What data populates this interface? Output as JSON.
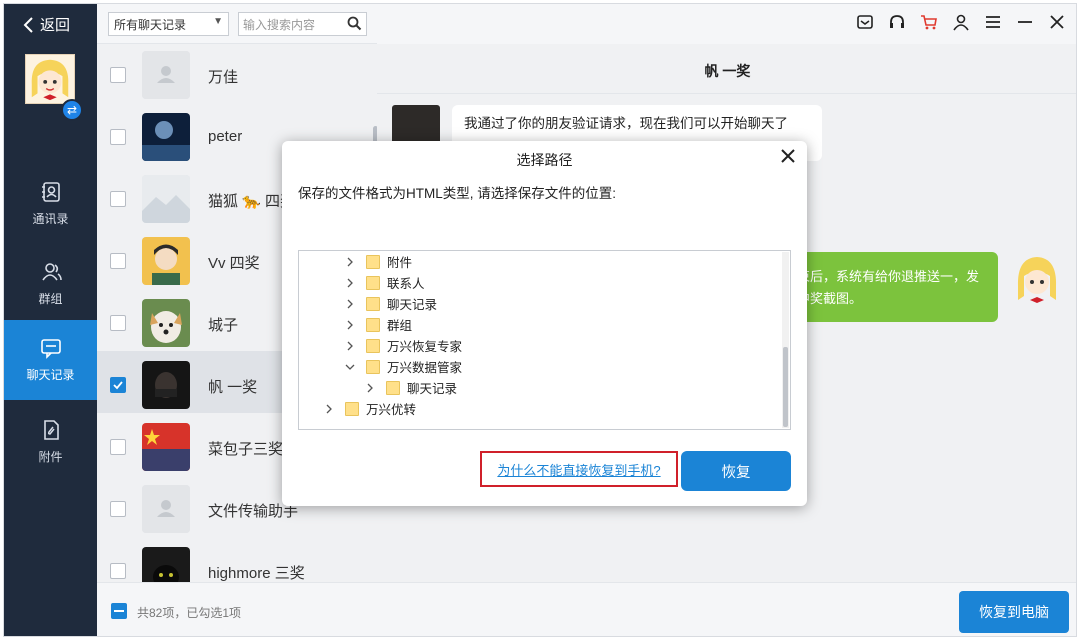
{
  "nav": {
    "back_label": "返回",
    "items": [
      {
        "label": "通讯录",
        "icon": "contacts-icon"
      },
      {
        "label": "群组",
        "icon": "group-icon"
      },
      {
        "label": "聊天记录",
        "icon": "chat-icon"
      },
      {
        "label": "附件",
        "icon": "attachment-icon"
      }
    ],
    "active_index": 2
  },
  "toolbar": {
    "filter_value": "所有聊天记录",
    "search_placeholder": "输入搜索内容"
  },
  "contacts": [
    {
      "name": "万佳",
      "checked": false
    },
    {
      "name": "peter",
      "checked": false
    },
    {
      "name": "猫狐 🐆 四奖",
      "checked": false
    },
    {
      "name": "Vv 四奖",
      "checked": false
    },
    {
      "name": "城子",
      "checked": false
    },
    {
      "name": "帆 一奖",
      "checked": true
    },
    {
      "name": "菜包子三奖",
      "checked": false
    },
    {
      "name": "文件传输助手",
      "checked": false
    },
    {
      "name": "highmore 三奖",
      "checked": false
    }
  ],
  "chat": {
    "title": "帆 一奖",
    "message_left": "我通过了你的朋友验证请求，现在我们可以开始聊天了",
    "message_right": "结束后，系统有给你退推送一，发下中奖截图。"
  },
  "bottom": {
    "count_text": "共82项，已勾选1项",
    "recover_pc_label": "恢复到电脑"
  },
  "dialog": {
    "title": "选择路径",
    "description": "保存的文件格式为HTML类型, 请选择保存文件的位置:",
    "tree": [
      {
        "label": "附件",
        "expanded": false,
        "level": 1
      },
      {
        "label": "联系人",
        "expanded": false,
        "level": 1
      },
      {
        "label": "聊天记录",
        "expanded": false,
        "level": 1
      },
      {
        "label": "群组",
        "expanded": false,
        "level": 1
      },
      {
        "label": "万兴恢复专家",
        "expanded": false,
        "level": 1
      },
      {
        "label": "万兴数据管家",
        "expanded": true,
        "level": 1
      },
      {
        "label": "聊天记录",
        "expanded": false,
        "level": 2
      },
      {
        "label": "万兴优转",
        "expanded": false,
        "level": 0
      }
    ],
    "why_link": "为什么不能直接恢复到手机?",
    "restore_label": "恢复"
  },
  "colors": {
    "accent": "#1b84d6",
    "nav_bg": "#1f2b3d",
    "bubble_green": "#7cc33d",
    "highlight_red": "#d0202a"
  }
}
